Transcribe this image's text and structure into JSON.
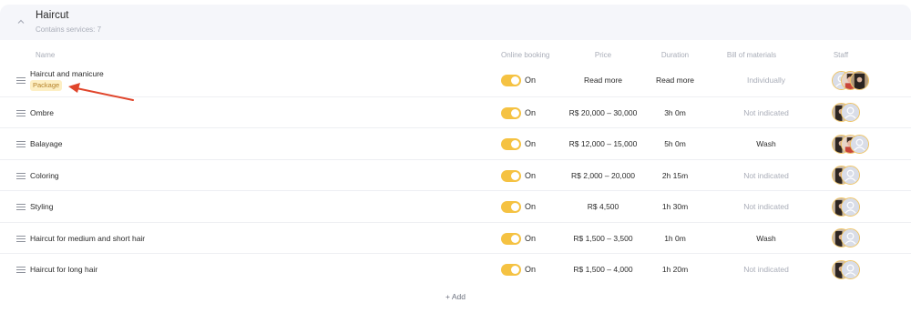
{
  "group": {
    "title": "Haircut",
    "subtitle": "Contains services: 7"
  },
  "columns": {
    "name": "Name",
    "online_booking": "Online booking",
    "price": "Price",
    "duration": "Duration",
    "bill_of_materials": "Bill of materials",
    "staff": "Staff"
  },
  "services": [
    {
      "name": "Haircut and manicure",
      "badge": "Package",
      "online": "On",
      "price": "Read more",
      "duration": "Read more",
      "materials": "Individually"
    },
    {
      "name": "Ombre",
      "online": "On",
      "price": "R$ 20,000 – 30,000",
      "duration": "3h 0m",
      "materials": "Not indicated"
    },
    {
      "name": "Balayage",
      "online": "On",
      "price": "R$ 12,000 – 15,000",
      "duration": "5h 0m",
      "materials": "Wash"
    },
    {
      "name": "Coloring",
      "online": "On",
      "price": "R$ 2,000 – 20,000",
      "duration": "2h 15m",
      "materials": "Not indicated"
    },
    {
      "name": "Styling",
      "online": "On",
      "price": "R$ 4,500",
      "duration": "1h 30m",
      "materials": "Not indicated"
    },
    {
      "name": "Haircut for medium and short hair",
      "online": "On",
      "price": "R$ 1,500 – 3,500",
      "duration": "1h 0m",
      "materials": "Wash"
    },
    {
      "name": "Haircut for long hair",
      "online": "On",
      "price": "R$ 1,500 – 4,000",
      "duration": "1h 20m",
      "materials": "Not indicated"
    }
  ],
  "add_label": "+ Add",
  "colors": {
    "accent_yellow": "#f5c242",
    "arrow_red": "#e0452b",
    "header_bg": "#f5f6fa"
  }
}
